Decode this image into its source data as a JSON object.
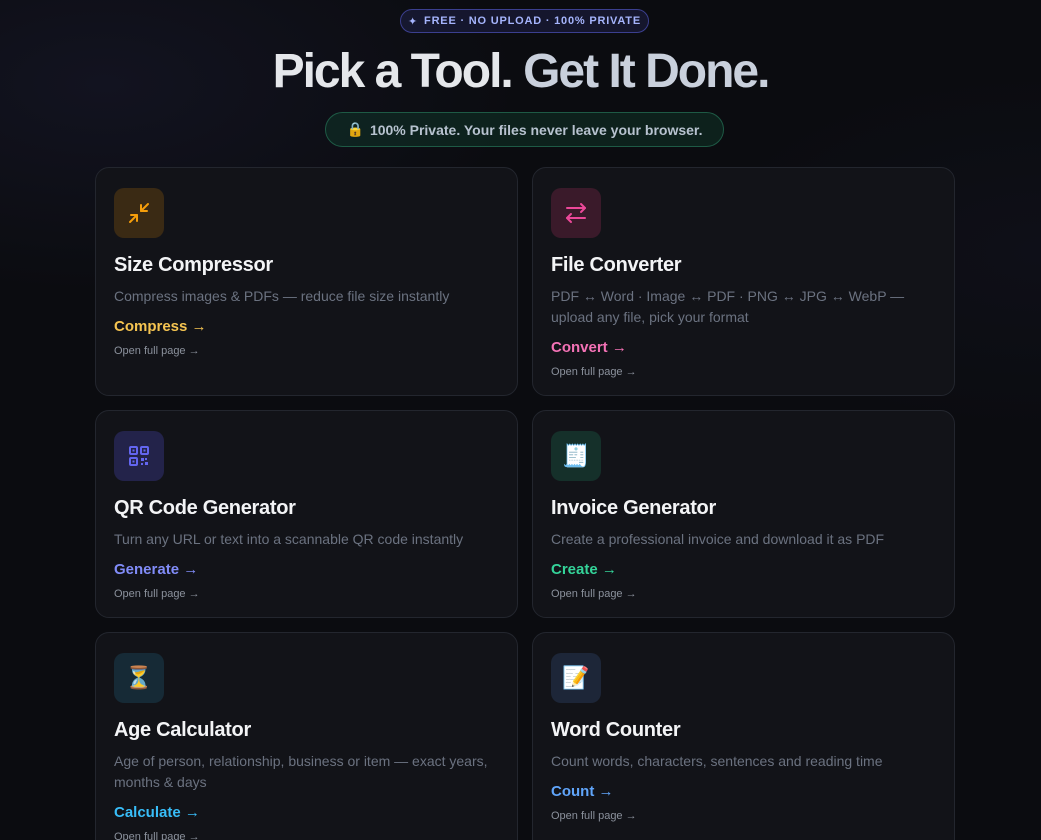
{
  "badge": {
    "icon": "sparkle-icon",
    "text": "FREE · NO UPLOAD · 100% PRIVATE"
  },
  "hero": {
    "title_part1": "Pick a Tool.",
    "title_part2": "Get It Done."
  },
  "privacy": {
    "icon": "lock-icon",
    "text": "100% Private. Your files never leave your browser."
  },
  "colors": {
    "compress": "#f5c451",
    "convert": "#f472b6",
    "generate": "#818cf8",
    "create": "#34d399",
    "calculate": "#38bdf8",
    "count": "#60a5fa"
  },
  "tools": [
    {
      "title": "Size Compressor",
      "description": "Compress images & PDFs — reduce file size instantly",
      "action": "Compress →",
      "link": "Open full page →",
      "icon": "compress-arrows-icon"
    },
    {
      "title": "File Converter",
      "description": "PDF ↔ Word · Image ↔ PDF · PNG ↔ JPG ↔ WebP — upload any file, pick your format",
      "action": "Convert →",
      "link": "Open full page →",
      "icon": "swap-arrows-icon"
    },
    {
      "title": "QR Code Generator",
      "description": "Turn any URL or text into a scannable QR code instantly",
      "action": "Generate →",
      "link": "Open full page →",
      "icon": "qr-code-icon"
    },
    {
      "title": "Invoice Generator",
      "description": "Create a professional invoice and download it as PDF",
      "action": "Create →",
      "link": "Open full page →",
      "icon": "receipt-icon"
    },
    {
      "title": "Age Calculator",
      "description": "Age of person, relationship, business or item — exact years, months & days",
      "action": "Calculate →",
      "link": "Open full page →",
      "icon": "hourglass-icon"
    },
    {
      "title": "Word Counter",
      "description": "Count words, characters, sentences and reading time",
      "action": "Count →",
      "link": "Open full page →",
      "icon": "memo-icon"
    }
  ]
}
